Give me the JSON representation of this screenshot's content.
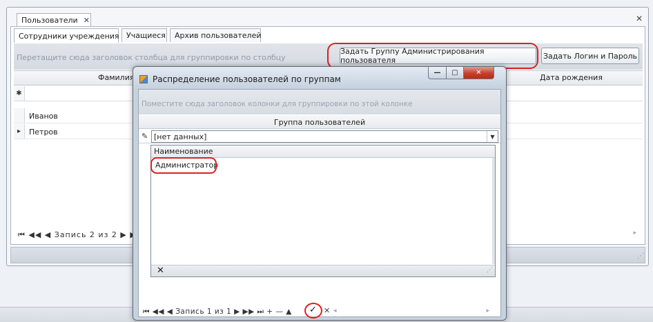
{
  "main": {
    "doc_tab": "Пользователи",
    "doc_tab_close": "✕",
    "window_close": "✕",
    "tabs": [
      "Сотрудники учреждения",
      "Учащиеся",
      "Архив пользователей"
    ],
    "group_hint": "Перетащите сюда заголовок столбца для группировки по столбцу",
    "btn_admin_group": "Задать Группу Администрирования пользователя",
    "btn_login": "Задать Логин и Пароль",
    "columns": [
      "Фамилия",
      "Дата рождения"
    ],
    "new_row_marker": "✱",
    "rows": [
      {
        "marker": "",
        "surname": "Иванов"
      },
      {
        "marker": "▸",
        "surname": "Петров"
      }
    ],
    "navigator": "⏮ ◀◀ ◀  Запись 2 из 2  ▶ ▶▶"
  },
  "dialog": {
    "title": "Распределение пользователей по группам",
    "min": "—",
    "max": "▢",
    "close": "✕",
    "group_hint": "Поместите сюда заголовок колонки для группировки по этой колонке",
    "column": "Группа пользователей",
    "combo_value": "[нет данных]",
    "popup_header": "Наименование",
    "popup_items": [
      "Администратор"
    ],
    "popup_clear": "✕",
    "navigator": "⏮ ◀◀ ◀  Запись 1 из 1  ▶ ▶▶ ⏭ +  —  ▲",
    "check": "✓",
    "cancel": "✕"
  },
  "colors": {
    "highlight": "#dd1f1f",
    "close_red": "#c4402a"
  }
}
